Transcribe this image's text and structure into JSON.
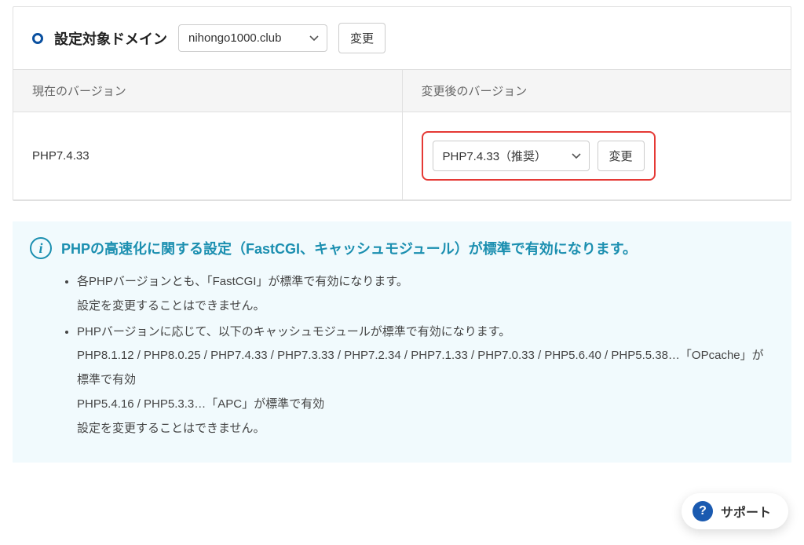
{
  "domain_row": {
    "label": "設定対象ドメイン",
    "selected": "nihongo1000.club",
    "change_button": "変更"
  },
  "table": {
    "headers": {
      "current": "現在のバージョン",
      "after": "変更後のバージョン"
    },
    "row": {
      "current": "PHP7.4.33",
      "after_selected": "PHP7.4.33（推奨）",
      "change_button": "変更"
    }
  },
  "info": {
    "title": "PHPの高速化に関する設定（FastCGI、キャッシュモジュール）が標準で有効になります。",
    "items": [
      {
        "main": "各PHPバージョンとも、「FastCGI」が標準で有効になります。",
        "sub": [
          "設定を変更することはできません。"
        ]
      },
      {
        "main": "PHPバージョンに応じて、以下のキャッシュモジュールが標準で有効になります。",
        "sub": [
          "PHP8.1.12 / PHP8.0.25 / PHP7.4.33 / PHP7.3.33 / PHP7.2.34 / PHP7.1.33 / PHP7.0.33 / PHP5.6.40 / PHP5.5.38…「OPcache」が標準で有効",
          "PHP5.4.16 / PHP5.3.3…「APC」が標準で有効",
          "設定を変更することはできません。"
        ]
      }
    ]
  },
  "support_label": "サポート"
}
